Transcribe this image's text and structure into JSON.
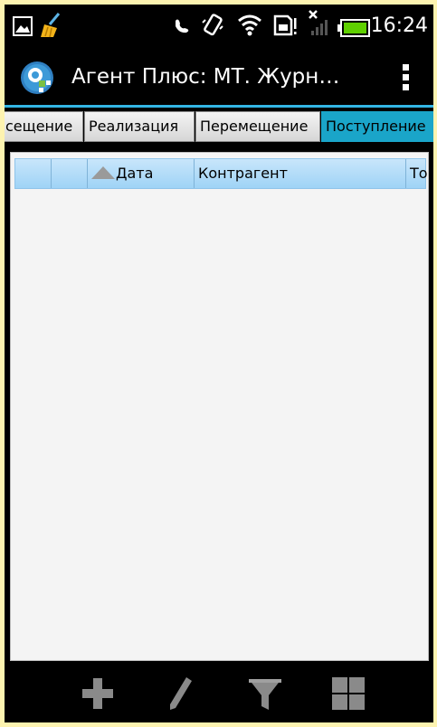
{
  "status_bar": {
    "time": "16:24",
    "icons": [
      "picture-icon",
      "broom-icon",
      "phone-icon",
      "vibrate-icon",
      "wifi-icon",
      "sd-card-icon",
      "no-signal-icon",
      "battery-icon"
    ]
  },
  "action_bar": {
    "title": "Агент Плюс: МТ. Журн…",
    "logo": "app-logo",
    "menu_icon": "overflow-menu-icon"
  },
  "tabs": [
    {
      "label": "сещение",
      "active": false
    },
    {
      "label": "Реализация",
      "active": false
    },
    {
      "label": "Перемещение",
      "active": false
    },
    {
      "label": "Поступление",
      "active": true
    }
  ],
  "table": {
    "columns": [
      {
        "label": ""
      },
      {
        "label": ""
      },
      {
        "label": "Дата",
        "sort": "ascending"
      },
      {
        "label": "Контрагент"
      },
      {
        "label": "То"
      }
    ],
    "rows": []
  },
  "bottom_toolbar": {
    "buttons": [
      "add-icon",
      "edit-icon",
      "filter-icon",
      "grid-view-icon"
    ]
  },
  "colors": {
    "accent": "#33b5e5",
    "active_tab": "#1aa5c9",
    "header_gradient_top": "#c8e6fb",
    "header_gradient_bottom": "#9fd3f6",
    "frame": "#fdf3b0"
  }
}
